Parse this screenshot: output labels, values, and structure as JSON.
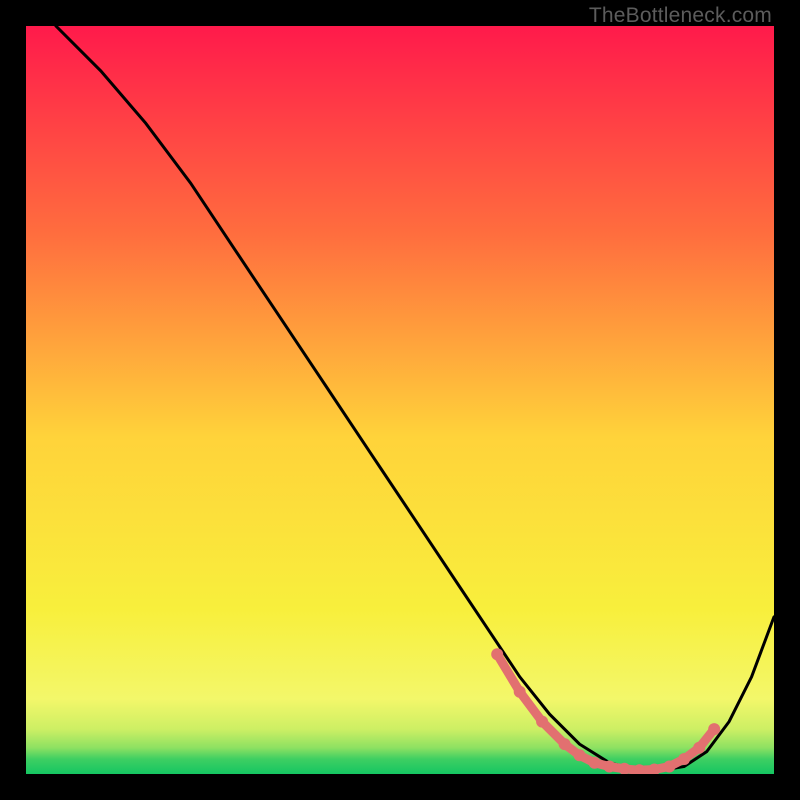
{
  "watermark": "TheBottleneck.com",
  "colors": {
    "top": "#ff1a4b",
    "q1": "#ff6e3e",
    "mid": "#ffd33a",
    "q3": "#f8ef3c",
    "bottom_yellow": "#f3f76a",
    "green1": "#cdef64",
    "green2": "#8de162",
    "green3": "#3ecf62",
    "green4": "#15c662",
    "curve": "#000000",
    "dots": "#e27070",
    "frame": "#000000"
  },
  "chart_data": {
    "type": "line",
    "title": "",
    "xlabel": "",
    "ylabel": "",
    "xlim": [
      0,
      100
    ],
    "ylim": [
      0,
      100
    ],
    "series": [
      {
        "name": "curve",
        "x": [
          4,
          10,
          16,
          22,
          28,
          34,
          40,
          46,
          52,
          58,
          62,
          66,
          70,
          74,
          78,
          82,
          85,
          88,
          91,
          94,
          97,
          100
        ],
        "y": [
          100,
          94,
          87,
          79,
          70,
          61,
          52,
          43,
          34,
          25,
          19,
          13,
          8,
          4,
          1.5,
          0.5,
          0.5,
          1,
          3,
          7,
          13,
          21
        ]
      }
    ],
    "valley_dots": {
      "x": [
        63,
        66,
        69,
        72,
        74,
        76,
        78,
        80,
        82,
        84,
        86,
        88,
        90,
        92
      ],
      "y": [
        16,
        11,
        7,
        4,
        2.5,
        1.5,
        1,
        0.7,
        0.5,
        0.6,
        1,
        2,
        3.5,
        6
      ]
    }
  }
}
